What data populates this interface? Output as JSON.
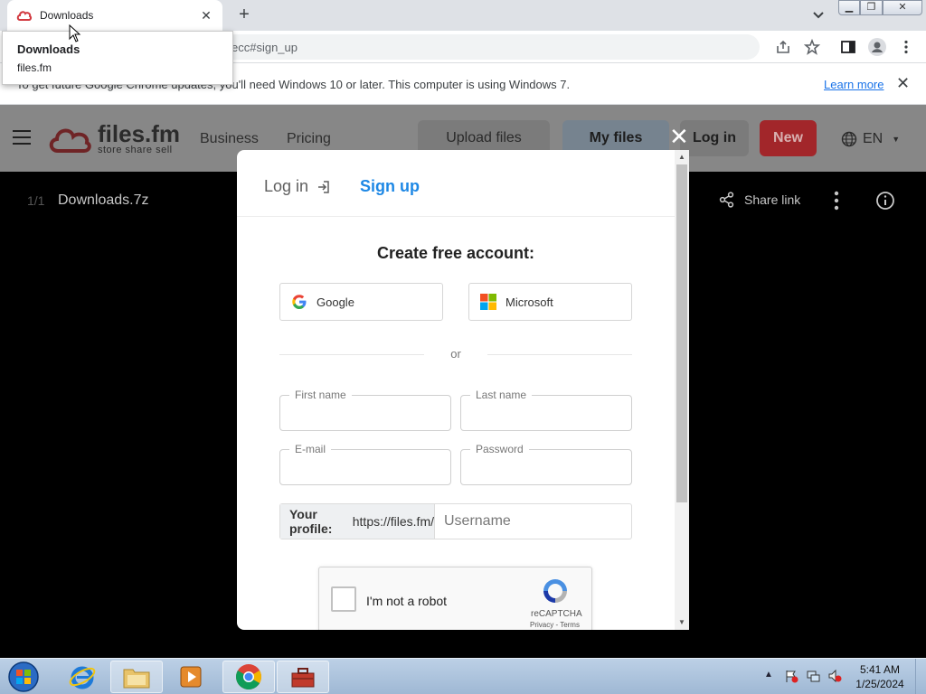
{
  "browser": {
    "tab_title": "Downloads",
    "hovercard_title": "Downloads",
    "hovercard_domain": "files.fm",
    "url_visible": "ecc#sign_up",
    "colors": {
      "tabstrip": "#dee1e6",
      "link": "#1a73e8"
    }
  },
  "infobar": {
    "message": "To get future Google Chrome updates, you'll need Windows 10 or later. This computer is using Windows 7.",
    "learn_more": "Learn more"
  },
  "site": {
    "logo_name": "files.fm",
    "logo_tagline": "store share sell",
    "nav": {
      "business": "Business",
      "pricing": "Pricing"
    },
    "buttons": {
      "upload": "Upload files",
      "myfiles": "My files",
      "login": "Log in",
      "new": "New"
    },
    "lang": "EN",
    "colors": {
      "brand_red": "#a2262a"
    }
  },
  "filebar": {
    "count": "1/1",
    "filename": "Downloads.7z",
    "share": "Share link"
  },
  "modal": {
    "tab_login": "Log in",
    "tab_signup": "Sign up",
    "heading": "Create free account:",
    "google": "Google",
    "microsoft": "Microsoft",
    "or": "or",
    "first_name": "First name",
    "last_name": "Last name",
    "email": "E-mail",
    "password": "Password",
    "profile_label": "Your profile:",
    "profile_prefix": "https://files.fm/",
    "username_placeholder": "Username",
    "captcha_text": "I'm not a robot",
    "captcha_brand": "reCAPTCHA",
    "captcha_terms": "Privacy - Terms",
    "colors": {
      "accent": "#1e88e5"
    }
  },
  "taskbar": {
    "time": "5:41 AM",
    "date": "1/25/2024"
  }
}
